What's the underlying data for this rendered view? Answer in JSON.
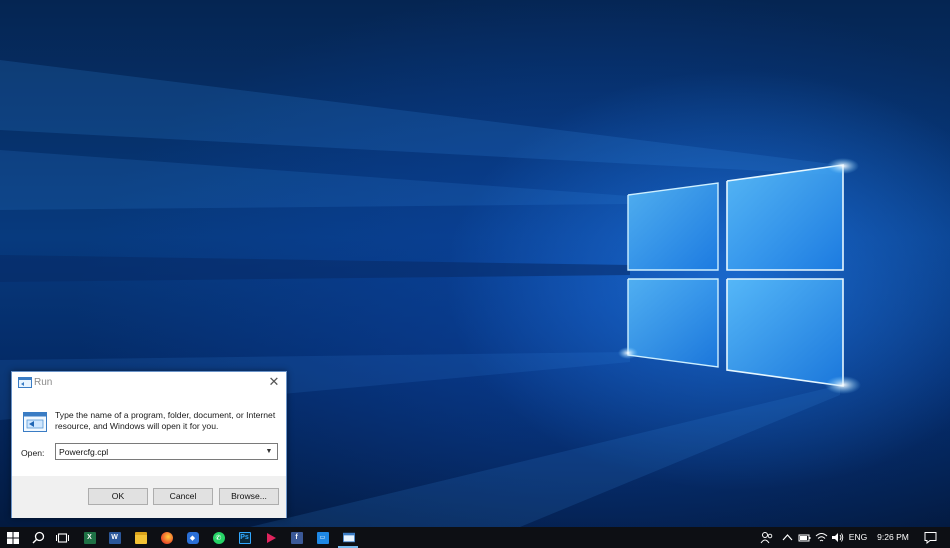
{
  "run_dialog": {
    "title": "Run",
    "description": "Type the name of a program, folder, document, or Internet resource, and Windows will open it for you.",
    "open_label": "Open:",
    "open_value": "Powercfg.cpl",
    "ok_label": "OK",
    "cancel_label": "Cancel",
    "browse_label": "Browse..."
  },
  "taskbar": {
    "pinned_apps": [
      "excel-icon",
      "word-icon",
      "file-explorer-icon",
      "firefox-icon",
      "maps-icon",
      "whatsapp-icon",
      "photoshop-icon",
      "media-player-icon",
      "facebook-icon",
      "remote-desktop-icon",
      "run-icon"
    ],
    "tray": {
      "language": "ENG",
      "time": "9:26 PM"
    }
  },
  "colors": {
    "taskbar_bg": "#0d0f14",
    "dialog_border": "#6a93c8",
    "wallpaper_accent": "#2f9bff"
  }
}
